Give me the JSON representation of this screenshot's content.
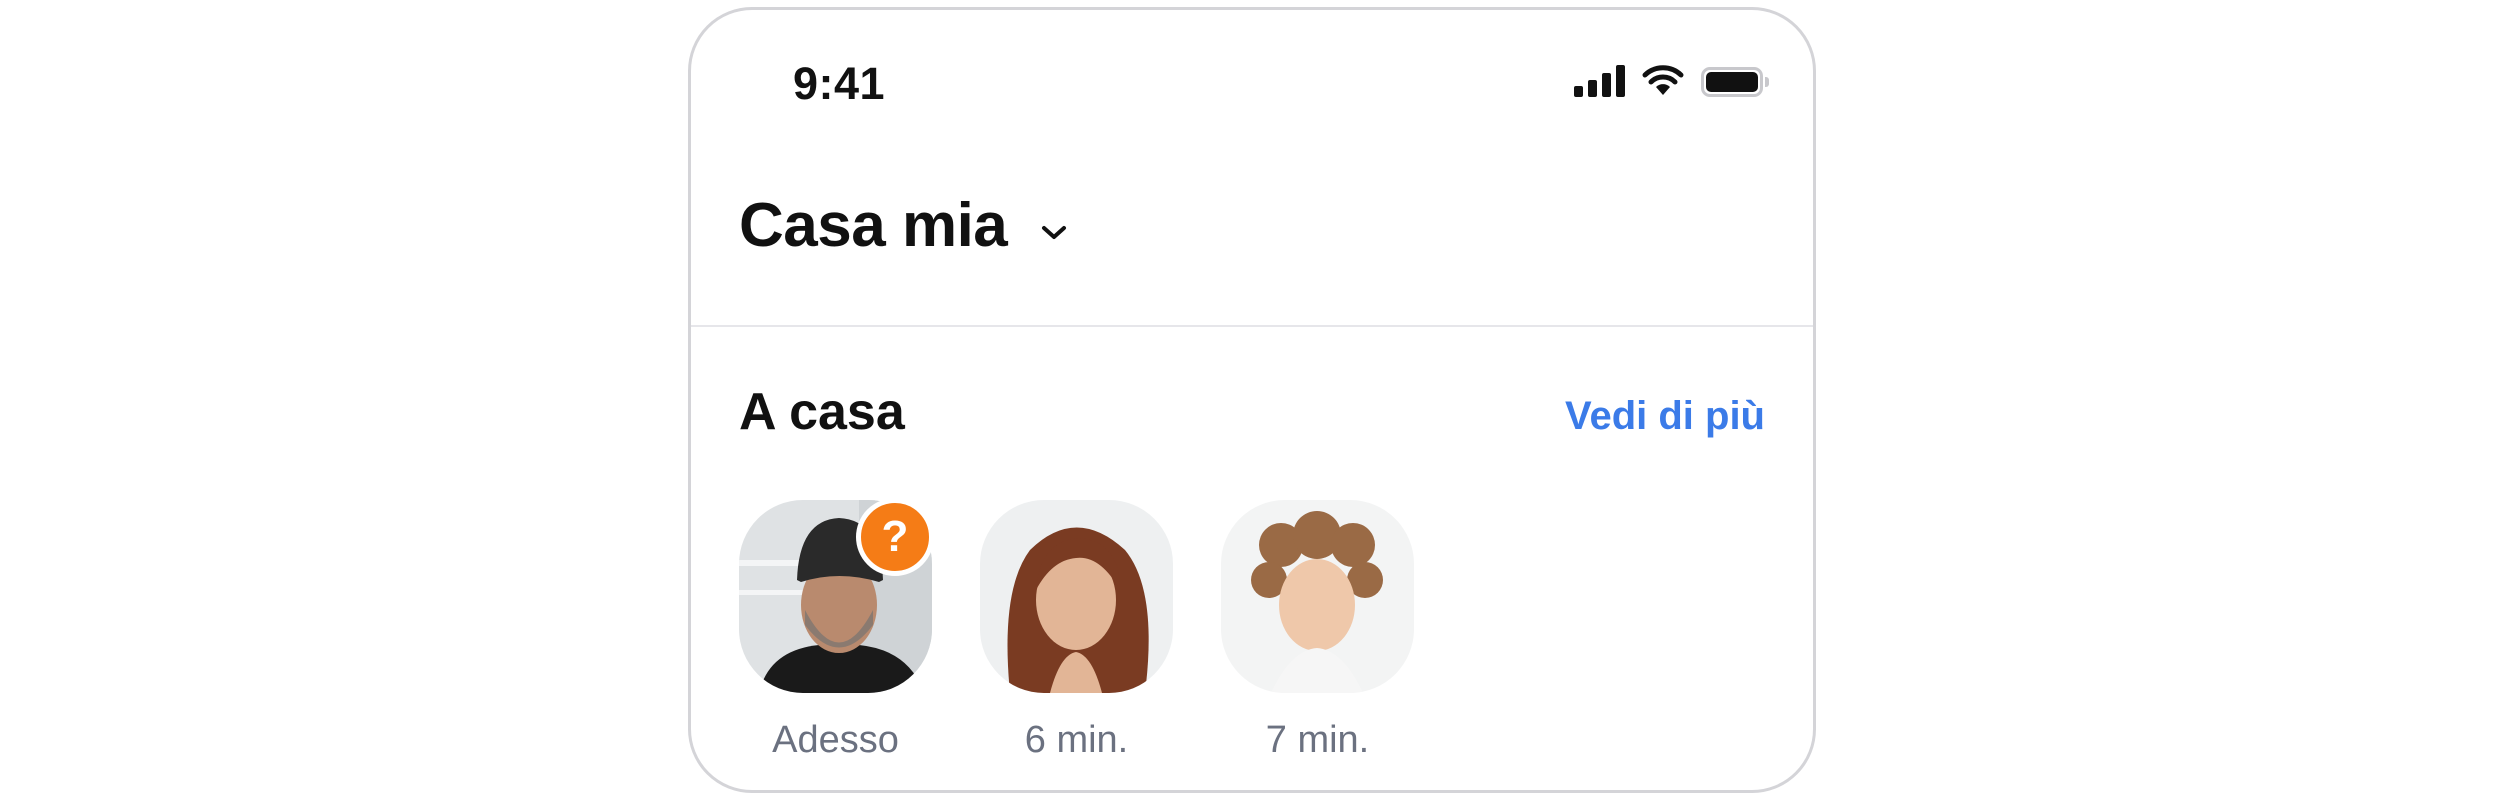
{
  "status_bar": {
    "time": "9:41",
    "signal_icon": "cellular-signal-icon",
    "wifi_icon": "wifi-icon",
    "battery_icon": "battery-icon"
  },
  "header": {
    "home_name": "Casa mia",
    "dropdown_icon": "chevron-down-icon"
  },
  "section": {
    "title": "A casa",
    "see_more_label": "Vedi di più"
  },
  "people": [
    {
      "time_label": "Adesso",
      "badge": "?",
      "badge_color": "#f57c16"
    },
    {
      "time_label": "6 min."
    },
    {
      "time_label": "7 min."
    }
  ],
  "colors": {
    "accent": "#3b7be8",
    "badge": "#f57c16",
    "muted_text": "#6b7180"
  }
}
